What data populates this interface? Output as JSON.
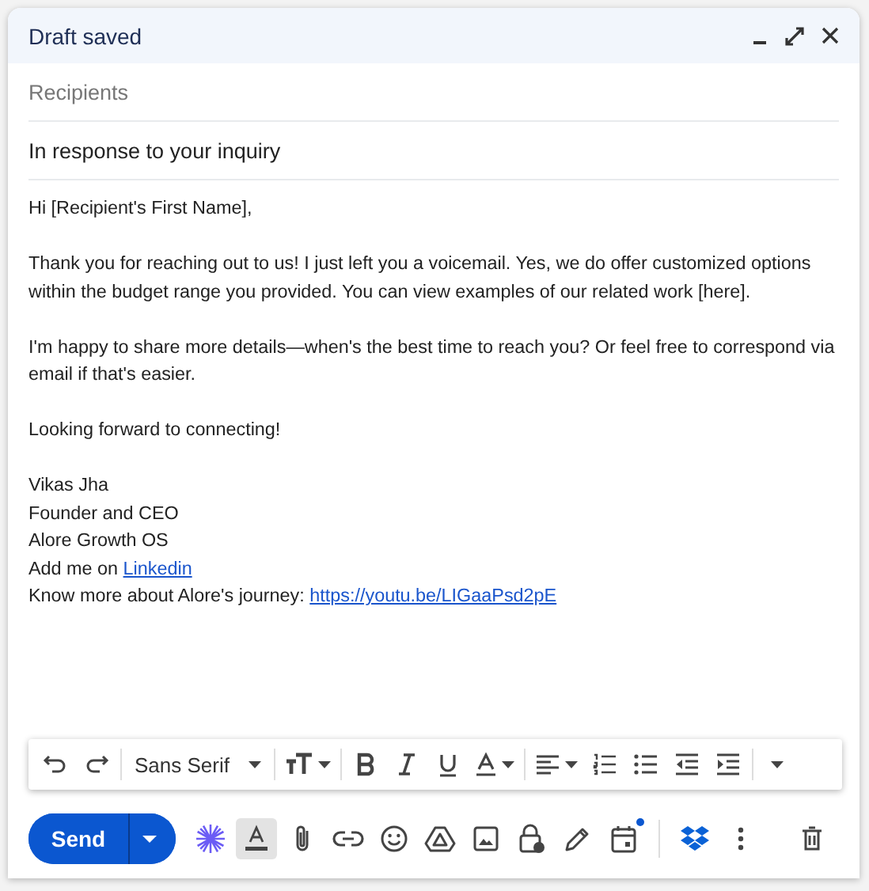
{
  "window": {
    "title": "Draft saved"
  },
  "fields": {
    "recipients": {
      "placeholder": "Recipients"
    },
    "subject": {
      "value": "In response to your inquiry"
    }
  },
  "body": [
    {
      "lines": [
        [
          {
            "kind": "text",
            "text": "Hi [Recipient's First Name],"
          }
        ]
      ]
    },
    {
      "lines": [
        [
          {
            "kind": "text",
            "text": "Thank you for reaching out to us! I just left you a voicemail. Yes, we do offer customized options within the budget range you provided. You can view examples of our related work [here]."
          }
        ]
      ]
    },
    {
      "lines": [
        [
          {
            "kind": "text",
            "text": "I'm happy to share more details—when's the best time to reach you? Or feel free to correspond via email if that's easier."
          }
        ]
      ]
    },
    {
      "lines": [
        [
          {
            "kind": "text",
            "text": "Looking forward to connecting!"
          }
        ]
      ]
    },
    {
      "lines": [
        [
          {
            "kind": "text",
            "text": "Vikas Jha"
          }
        ],
        [
          {
            "kind": "text",
            "text": "Founder and CEO"
          }
        ],
        [
          {
            "kind": "text",
            "text": "Alore Growth OS"
          }
        ],
        [
          {
            "kind": "text",
            "text": "Add me on "
          },
          {
            "kind": "link",
            "text": "Linkedin"
          }
        ],
        [
          {
            "kind": "text",
            "text": "Know more about Alore's journey: "
          },
          {
            "kind": "link",
            "text": "https://youtu.be/LIGaaPsd2pE"
          }
        ]
      ]
    }
  ],
  "format_toolbar": [
    {
      "kind": "undo"
    },
    {
      "kind": "redo"
    },
    {
      "kind": "separator"
    },
    {
      "kind": "font",
      "label": "Sans Serif"
    },
    {
      "kind": "separator"
    },
    {
      "kind": "size"
    },
    {
      "kind": "separator"
    },
    {
      "kind": "bold"
    },
    {
      "kind": "italic"
    },
    {
      "kind": "underline"
    },
    {
      "kind": "color"
    },
    {
      "kind": "separator"
    },
    {
      "kind": "align"
    },
    {
      "kind": "numbered"
    },
    {
      "kind": "bulleted"
    },
    {
      "kind": "outdent"
    },
    {
      "kind": "indent"
    },
    {
      "kind": "separator"
    },
    {
      "kind": "more"
    }
  ],
  "send_button": {
    "label": "Send"
  },
  "actions": [
    {
      "kind": "sparkle",
      "selected": false
    },
    {
      "kind": "formatting",
      "selected": true
    },
    {
      "kind": "attach",
      "selected": false
    },
    {
      "kind": "link",
      "selected": false
    },
    {
      "kind": "emoji",
      "selected": false
    },
    {
      "kind": "drive",
      "selected": false
    },
    {
      "kind": "photo",
      "selected": false
    },
    {
      "kind": "lock",
      "selected": false
    },
    {
      "kind": "pen",
      "selected": false
    },
    {
      "kind": "calendar",
      "selected": false,
      "notification": true
    },
    {
      "kind": "separator"
    },
    {
      "kind": "dropbox",
      "selected": false
    },
    {
      "kind": "more",
      "selected": false
    },
    {
      "kind": "trash",
      "selected": false
    }
  ]
}
